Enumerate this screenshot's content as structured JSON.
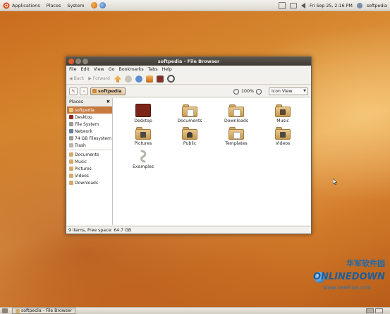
{
  "top_panel": {
    "menus": [
      "Applications",
      "Places",
      "System"
    ],
    "clock": "Fri Sep 25,  2:16 PM",
    "user": "softpedia"
  },
  "window": {
    "title": "softpedia - File Browser",
    "menubar": [
      "File",
      "Edit",
      "View",
      "Go",
      "Bookmarks",
      "Tabs",
      "Help"
    ],
    "toolbar": {
      "back": "Back",
      "forward": "Forward"
    },
    "location": {
      "crumb": "softpedia",
      "zoom": "100%",
      "view": "Icon View"
    },
    "sidebar": {
      "header": "Places",
      "items": [
        "softpedia",
        "Desktop",
        "File System",
        "Network",
        "74 GB Filesystem",
        "Trash"
      ],
      "bookmarks": [
        "Documents",
        "Music",
        "Pictures",
        "Videos",
        "Downloads"
      ]
    },
    "files": [
      {
        "label": "Desktop",
        "icon": "desktop-folder-icon"
      },
      {
        "label": "Documents",
        "icon": "documents-folder-icon"
      },
      {
        "label": "Downloads",
        "icon": "downloads-folder-icon"
      },
      {
        "label": "Music",
        "icon": "music-folder-icon"
      },
      {
        "label": "Pictures",
        "icon": "pictures-folder-icon"
      },
      {
        "label": "Public",
        "icon": "public-folder-icon"
      },
      {
        "label": "Templates",
        "icon": "templates-folder-icon"
      },
      {
        "label": "Videos",
        "icon": "videos-folder-icon"
      },
      {
        "label": "Examples",
        "icon": "examples-link-icon"
      }
    ],
    "status": "9 items, Free space: 64.7 GB"
  },
  "taskbar": {
    "task": "softpedia - File Browser"
  },
  "watermark": {
    "cn": "华军软件园",
    "logo": "ONLINEDOWN",
    "url": "www.newhua.com"
  },
  "colors": {
    "selection": "#c77a3d",
    "folder": "#d3ab68",
    "titlebar": "#3e3a34"
  }
}
